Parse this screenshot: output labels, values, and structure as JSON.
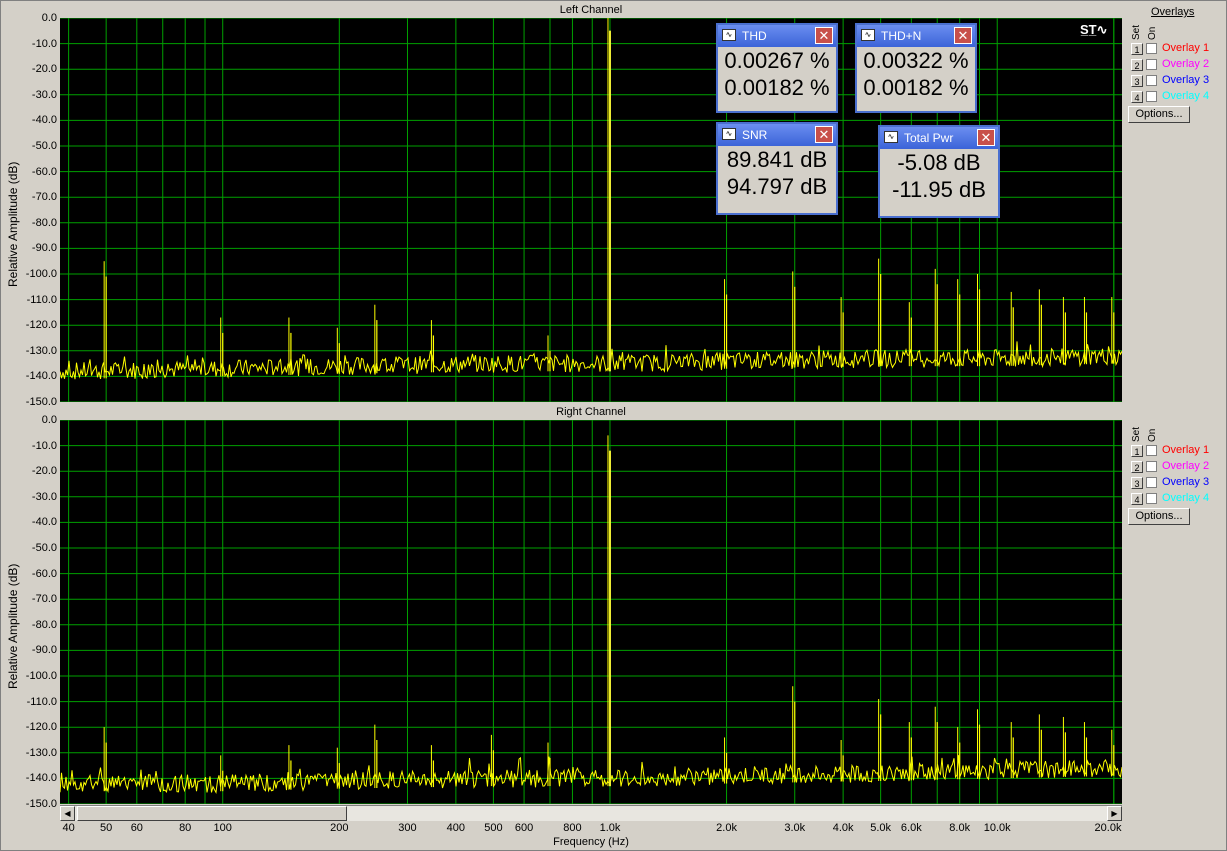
{
  "channels": {
    "left": {
      "title": "Left Channel"
    },
    "right": {
      "title": "Right Channel"
    }
  },
  "y_axis": {
    "title": "Relative Amplitude (dB)",
    "ticks": [
      "0.0",
      "-10.0",
      "-20.0",
      "-30.0",
      "-40.0",
      "-50.0",
      "-60.0",
      "-70.0",
      "-80.0",
      "-90.0",
      "-100.0",
      "-110.0",
      "-120.0",
      "-130.0",
      "-140.0",
      "-150.0"
    ]
  },
  "x_axis": {
    "title": "Frequency (Hz)",
    "ticks": [
      {
        "f": 40,
        "label": "40"
      },
      {
        "f": 50,
        "label": "50"
      },
      {
        "f": 60,
        "label": "60"
      },
      {
        "f": 80,
        "label": "80"
      },
      {
        "f": 100,
        "label": "100"
      },
      {
        "f": 200,
        "label": "200"
      },
      {
        "f": 300,
        "label": "300"
      },
      {
        "f": 400,
        "label": "400"
      },
      {
        "f": 500,
        "label": "500"
      },
      {
        "f": 600,
        "label": "600"
      },
      {
        "f": 800,
        "label": "800"
      },
      {
        "f": 1000,
        "label": "1.0k"
      },
      {
        "f": 2000,
        "label": "2.0k"
      },
      {
        "f": 3000,
        "label": "3.0k"
      },
      {
        "f": 4000,
        "label": "4.0k"
      },
      {
        "f": 5000,
        "label": "5.0k"
      },
      {
        "f": 6000,
        "label": "6.0k"
      },
      {
        "f": 8000,
        "label": "8.0k"
      },
      {
        "f": 10000,
        "label": "10.0k"
      },
      {
        "f": 20000,
        "label": "20.0k"
      }
    ]
  },
  "overlays": {
    "title": "Overlays",
    "set_label": "Set",
    "on_label": "On",
    "items": [
      {
        "num": "1",
        "label": "Overlay 1",
        "color": "#ff0000"
      },
      {
        "num": "2",
        "label": "Overlay 2",
        "color": "#ff00ff"
      },
      {
        "num": "3",
        "label": "Overlay 3",
        "color": "#0000ff"
      },
      {
        "num": "4",
        "label": "Overlay 4",
        "color": "#00ffff"
      }
    ],
    "options_label": "Options..."
  },
  "meters": {
    "thd": {
      "title": "THD",
      "v1": "0.00267 %",
      "v2": "0.00182 %"
    },
    "thdn": {
      "title": "THD+N",
      "v1": "0.00322 %",
      "v2": "0.00182 %"
    },
    "snr": {
      "title": "SNR",
      "v1": "89.841 dB",
      "v2": "94.797 dB"
    },
    "pwr": {
      "title": "Total Pwr",
      "v1": "-5.08 dB",
      "v2": "-11.95 dB"
    }
  },
  "chart_data": [
    {
      "type": "line",
      "title": "Left Channel",
      "xlabel": "Frequency (Hz)",
      "ylabel": "Relative Amplitude (dB)",
      "xlim": [
        38,
        21000
      ],
      "ylim": [
        -150,
        0
      ],
      "x_scale": "log",
      "grid": true,
      "series": [
        {
          "color": "#ffff00",
          "noise_floor": [
            [
              40,
              -138
            ],
            [
              100,
              -137
            ],
            [
              200,
              -136
            ],
            [
              500,
              -135
            ],
            [
              1000,
              -135
            ],
            [
              2000,
              -134
            ],
            [
              5000,
              -133
            ],
            [
              10000,
              -133
            ],
            [
              20000,
              -132
            ]
          ],
          "peaks": [
            [
              50,
              -101
            ],
            [
              100,
              -123
            ],
            [
              150,
              -123
            ],
            [
              200,
              -127
            ],
            [
              250,
              -118
            ],
            [
              350,
              -124
            ],
            [
              700,
              -130
            ],
            [
              1000,
              -5
            ],
            [
              2000,
              -108
            ],
            [
              3000,
              -105
            ],
            [
              4000,
              -115
            ],
            [
              5000,
              -100
            ],
            [
              6000,
              -117
            ],
            [
              7000,
              -104
            ],
            [
              8000,
              -108
            ],
            [
              9000,
              -106
            ],
            [
              11000,
              -113
            ],
            [
              13000,
              -112
            ],
            [
              15000,
              -115
            ],
            [
              17000,
              -115
            ],
            [
              20000,
              -115
            ]
          ]
        }
      ]
    },
    {
      "type": "line",
      "title": "Right Channel",
      "xlabel": "Frequency (Hz)",
      "ylabel": "Relative Amplitude (dB)",
      "xlim": [
        38,
        21000
      ],
      "ylim": [
        -150,
        0
      ],
      "x_scale": "log",
      "grid": true,
      "series": [
        {
          "color": "#ffff00",
          "noise_floor": [
            [
              40,
              -142
            ],
            [
              100,
              -142
            ],
            [
              200,
              -141
            ],
            [
              500,
              -140
            ],
            [
              1000,
              -140
            ],
            [
              2000,
              -139
            ],
            [
              5000,
              -138
            ],
            [
              10000,
              -137
            ],
            [
              20000,
              -136
            ]
          ],
          "peaks": [
            [
              50,
              -126
            ],
            [
              100,
              -137
            ],
            [
              150,
              -133
            ],
            [
              200,
              -134
            ],
            [
              250,
              -125
            ],
            [
              350,
              -133
            ],
            [
              500,
              -129
            ],
            [
              700,
              -132
            ],
            [
              1000,
              -12
            ],
            [
              2000,
              -130
            ],
            [
              3000,
              -110
            ],
            [
              4000,
              -131
            ],
            [
              5000,
              -115
            ],
            [
              6000,
              -124
            ],
            [
              7000,
              -118
            ],
            [
              8000,
              -126
            ],
            [
              9000,
              -119
            ],
            [
              11000,
              -124
            ],
            [
              13000,
              -121
            ],
            [
              15000,
              -122
            ],
            [
              17000,
              -124
            ],
            [
              20000,
              -127
            ]
          ]
        }
      ]
    }
  ]
}
